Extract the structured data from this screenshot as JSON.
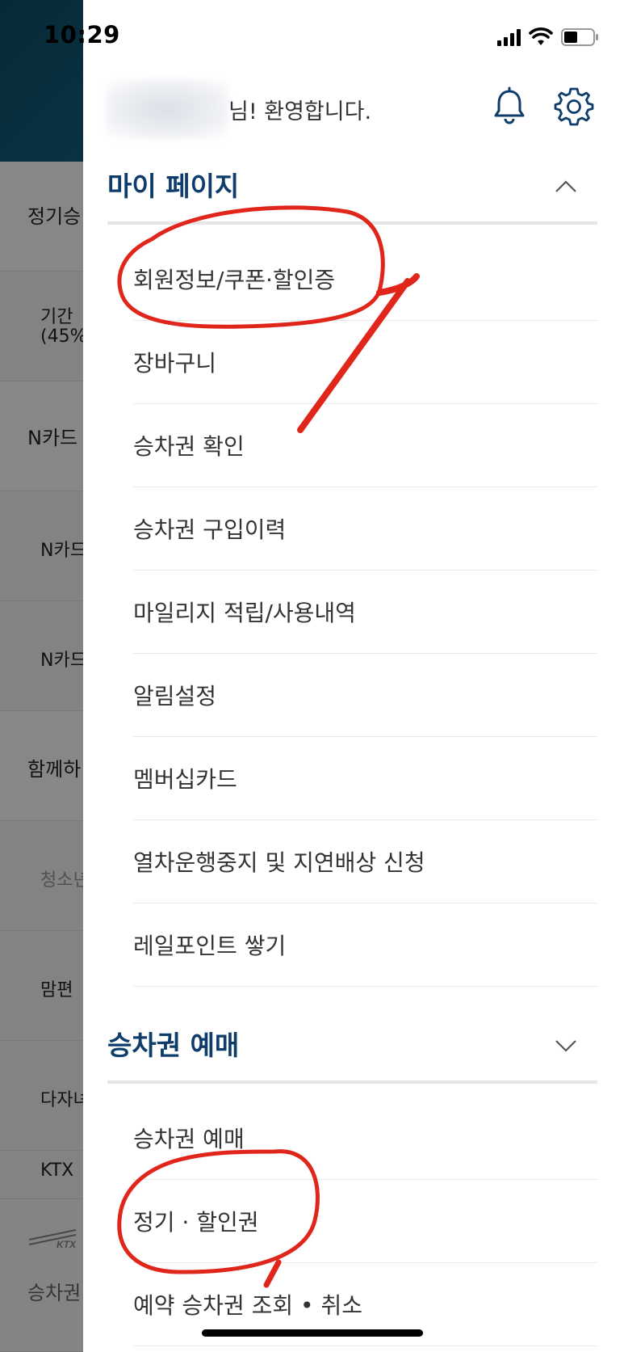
{
  "status_bar": {
    "time": "10:29"
  },
  "background_app": {
    "items": [
      "정기승",
      "기간",
      "(45%",
      "N카드",
      "N카드",
      "N카드",
      "함께하",
      "청소년",
      "맘편",
      "다자녀",
      "KTX",
      "승차권"
    ]
  },
  "drawer": {
    "welcome_suffix": "님! 환영합니다.",
    "icons": {
      "bell": "bell-icon",
      "gear": "gear-icon"
    },
    "sections": [
      {
        "title": "마이 페이지",
        "expanded": true,
        "items": [
          "회원정보/쿠폰·할인증",
          "장바구니",
          "승차권 확인",
          "승차권 구입이력",
          "마일리지 적립/사용내역",
          "알림설정",
          "멤버십카드",
          "열차운행중지 및 지연배상 신청",
          "레일포인트 쌓기"
        ]
      },
      {
        "title": "승차권 예매",
        "expanded": true,
        "items": [
          "승차권 예매",
          "정기 · 할인권",
          "예약 승차권 조회 • 취소"
        ]
      }
    ]
  },
  "colors": {
    "section_title": "#0e3d6b",
    "annotation_red": "#e0251b",
    "header_teal": "#14718b"
  }
}
